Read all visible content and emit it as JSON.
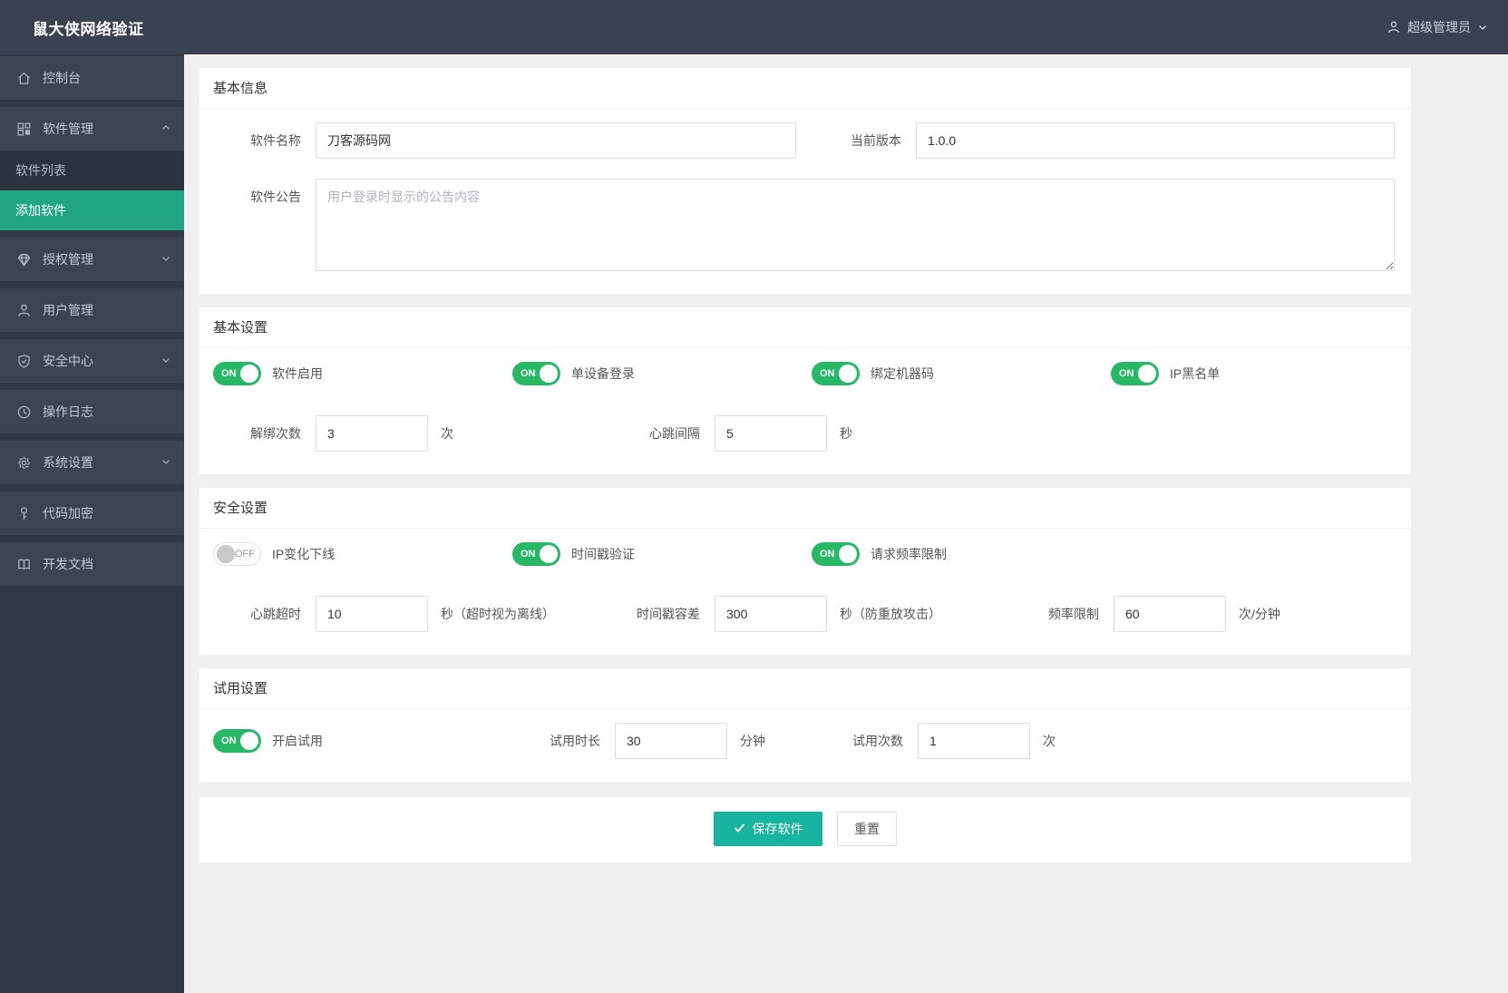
{
  "header": {
    "logo_text": "鼠大侠网络验证",
    "user_name": "超级管理员"
  },
  "sidebar": {
    "items": [
      {
        "label": "控制台",
        "icon": "home-icon"
      },
      {
        "label": "软件管理",
        "icon": "grid-icon",
        "expanded": true
      },
      {
        "label": "软件列表",
        "submenu": true
      },
      {
        "label": "添加软件",
        "submenu": true,
        "active": true
      },
      {
        "label": "授权管理",
        "icon": "diamond-icon"
      },
      {
        "label": "用户管理",
        "icon": "user-icon"
      },
      {
        "label": "安全中心",
        "icon": "shield-icon"
      },
      {
        "label": "操作日志",
        "icon": "clock-icon"
      },
      {
        "label": "系统设置",
        "icon": "gear-icon"
      },
      {
        "label": "代码加密",
        "icon": "key-icon"
      },
      {
        "label": "开发文档",
        "icon": "book-icon"
      }
    ]
  },
  "basic_info": {
    "title": "基本信息",
    "name_label": "软件名称",
    "name_value": "刀客源码网",
    "version_label": "当前版本",
    "version_value": "1.0.0",
    "notice_label": "软件公告",
    "notice_placeholder": "用户登录时显示的公告内容"
  },
  "basic_settings": {
    "title": "基本设置",
    "toggles": [
      {
        "label": "软件启用",
        "state": "ON"
      },
      {
        "label": "单设备登录",
        "state": "ON"
      },
      {
        "label": "绑定机器码",
        "state": "ON"
      },
      {
        "label": "IP黑名单",
        "state": "ON"
      }
    ],
    "fields": {
      "unbind": {
        "label": "解绑次数",
        "value": "3",
        "suffix": "次"
      },
      "heartbeat": {
        "label": "心跳间隔",
        "value": "5",
        "suffix": "秒"
      }
    }
  },
  "security_settings": {
    "title": "安全设置",
    "toggles": [
      {
        "label": "IP变化下线",
        "state": "OFF"
      },
      {
        "label": "时间戳验证",
        "state": "ON"
      },
      {
        "label": "请求频率限制",
        "state": "ON"
      }
    ],
    "fields": {
      "timeout": {
        "label": "心跳超时",
        "value": "10",
        "suffix": "秒（超时视为离线）"
      },
      "tolerance": {
        "label": "时间戳容差",
        "value": "300",
        "suffix": "秒（防重放攻击）"
      },
      "rate": {
        "label": "频率限制",
        "value": "60",
        "suffix": "次/分钟"
      }
    }
  },
  "trial_settings": {
    "title": "试用设置",
    "toggle": {
      "label": "开启试用",
      "state": "ON"
    },
    "fields": {
      "duration": {
        "label": "试用时长",
        "value": "30",
        "suffix": "分钟"
      },
      "count": {
        "label": "试用次数",
        "value": "1",
        "suffix": "次"
      }
    }
  },
  "actions": {
    "save": "保存软件",
    "reset": "重置"
  },
  "colors": {
    "header_bg": "#3a4150",
    "sidebar_active": "#21a685",
    "toggle_on": "#26b864",
    "save_button": "#17b5a0"
  }
}
